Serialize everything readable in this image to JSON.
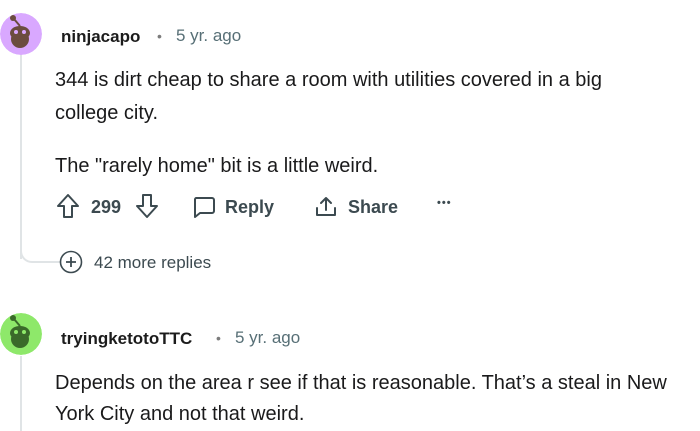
{
  "comments": [
    {
      "username": "ninjacapo",
      "separator": "•",
      "time": "5 yr. ago",
      "body": [
        "344 is dirt cheap to share a room with utilities covered in a big",
        "college city.",
        "The \"rarely home\" bit is a little weird."
      ],
      "actions": {
        "score": "299",
        "reply": "Reply",
        "share": "Share",
        "more": "•••"
      },
      "more_replies": "42 more replies",
      "avatar_color": "#d9a8ff"
    },
    {
      "username": "tryingketotoTTC",
      "separator": "•",
      "time": "5 yr. ago",
      "body": [
        "Depends on the area r see if that is reasonable. That’s a steal in New",
        "York City and not that weird."
      ],
      "avatar_color": "#8ee86a"
    }
  ],
  "colors": {
    "text": "#1a1a1b",
    "muted": "#576f76",
    "thread": "#e0e4e6"
  }
}
